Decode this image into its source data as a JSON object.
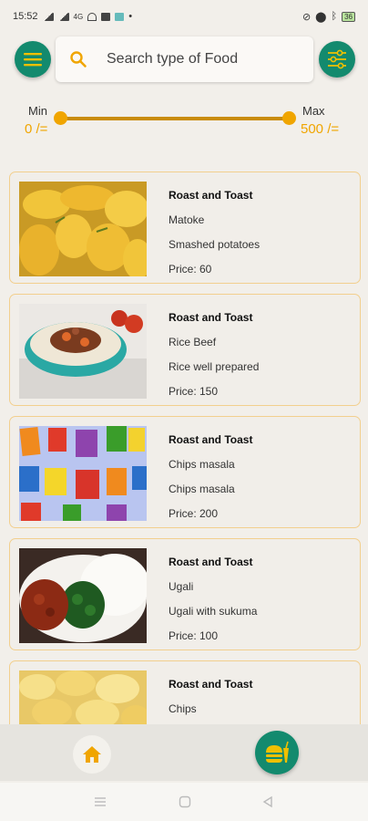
{
  "status_bar": {
    "time": "15:52",
    "network": "4G",
    "battery": "36"
  },
  "search": {
    "placeholder": "Search type of Food"
  },
  "price_filter": {
    "min_label": "Min",
    "max_label": "Max",
    "min_value": "0 /=",
    "max_value": "500 /="
  },
  "food_items": [
    {
      "shop": "Roast and Toast",
      "name": "Matoke",
      "description": "Smashed potatoes",
      "price": "Price: 60",
      "image": "matoke-photo"
    },
    {
      "shop": "Roast and Toast",
      "name": "Rice Beef",
      "description": "Rice well prepared",
      "price": "Price: 150",
      "image": "rice-beef-photo"
    },
    {
      "shop": "Roast and Toast",
      "name": "Chips masala",
      "description": "Chips masala",
      "price": "Price: 200",
      "image": "chips-packets-photo"
    },
    {
      "shop": "Roast and Toast",
      "name": "Ugali",
      "description": "Ugali with sukuma",
      "price": "Price: 100",
      "image": "ugali-photo"
    },
    {
      "shop": "Roast and Toast",
      "name": "Chips",
      "description": "",
      "price": "",
      "image": "potato-chips-photo"
    }
  ],
  "colors": {
    "accent_green": "#138a6e",
    "accent_orange": "#f0a500",
    "card_border": "#f2cf8e",
    "background": "#f2efea"
  },
  "icons": {
    "menu": "hamburger-icon",
    "search": "search-icon",
    "filter": "sliders-icon",
    "home": "home-icon",
    "cart": "burger-drink-icon"
  }
}
